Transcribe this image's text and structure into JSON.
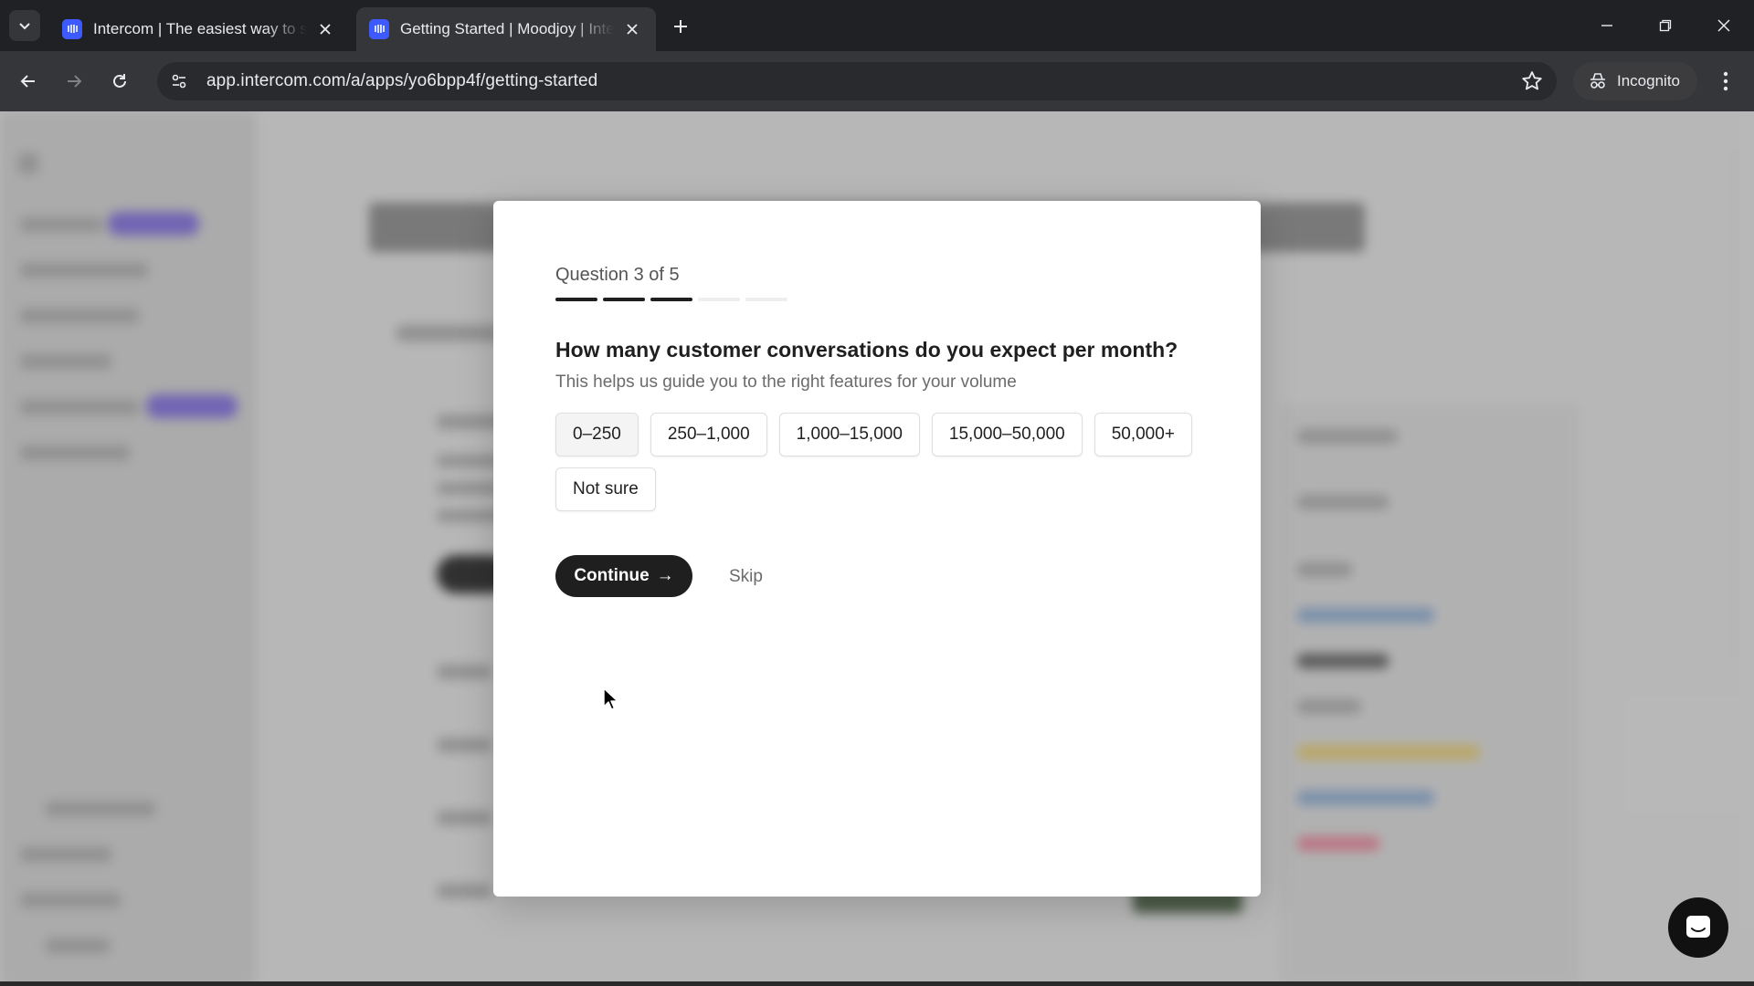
{
  "browser": {
    "tabs": [
      {
        "title": "Intercom | The easiest way to scale",
        "active": false
      },
      {
        "title": "Getting Started | Moodjoy | Intercom",
        "active": true
      }
    ],
    "url": "app.intercom.com/a/apps/yo6bpp4f/getting-started",
    "incognito_label": "Incognito"
  },
  "modal": {
    "question_counter": "Question 3 of 5",
    "progress": {
      "current": 3,
      "total": 5
    },
    "question": "How many customer conversations do you expect per month?",
    "helper": "This helps us guide you to the right features for your volume",
    "options": [
      "0–250",
      "250–1,000",
      "1,000–15,000",
      "15,000–50,000",
      "50,000+",
      "Not sure"
    ],
    "continue_label": "Continue",
    "continue_arrow": "→",
    "skip_label": "Skip"
  },
  "colors": {
    "brand": "#3d5afe",
    "primary_button": "#1f1f1f"
  }
}
